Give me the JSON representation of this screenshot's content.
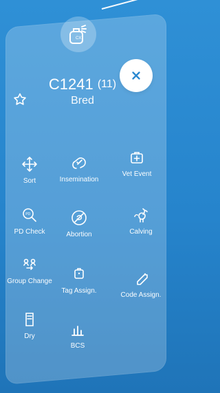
{
  "header": {
    "id": "C1241",
    "count": "(11)",
    "status": "Bred"
  },
  "actions": [
    {
      "label": "Sort",
      "icon": "sort-icon"
    },
    {
      "label": "Insemination",
      "icon": "insemination-icon"
    },
    {
      "label": "Vet Event",
      "icon": "vet-event-icon"
    },
    {
      "label": "PD Check",
      "icon": "pd-check-icon"
    },
    {
      "label": "Abortion",
      "icon": "abortion-icon"
    },
    {
      "label": "Calving",
      "icon": "calving-icon"
    },
    {
      "label": "Group Change",
      "icon": "group-change-icon"
    },
    {
      "label": "Tag Assign.",
      "icon": "tag-assign-icon"
    },
    {
      "label": "Code Assign.",
      "icon": "code-assign-icon"
    },
    {
      "label": "Dry",
      "icon": "dry-icon"
    },
    {
      "label": "BCS",
      "icon": "bcs-icon"
    }
  ],
  "colors": {
    "background": "#2a88d0",
    "panel": "rgba(255,255,255,0.22)",
    "accent": "#2a88d0",
    "text": "#ffffff"
  }
}
